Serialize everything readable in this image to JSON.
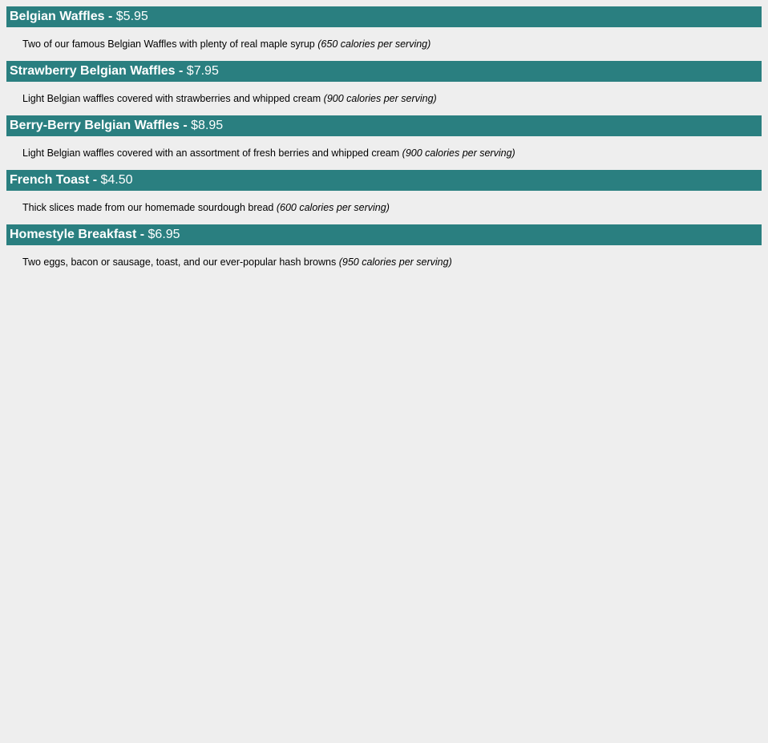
{
  "colors": {
    "header_background": "#2a7f80",
    "header_text": "#ffffff",
    "page_background": "#eeeeee",
    "body_text": "#000000"
  },
  "menu": {
    "separator": " - ",
    "items": [
      {
        "name": "Belgian Waffles",
        "price": "$5.95",
        "description": "Two of our famous Belgian Waffles with plenty of real maple syrup",
        "calories": "(650 calories per serving)"
      },
      {
        "name": "Strawberry Belgian Waffles",
        "price": "$7.95",
        "description": "Light Belgian waffles covered with strawberries and whipped cream",
        "calories": "(900 calories per serving)"
      },
      {
        "name": "Berry-Berry Belgian Waffles",
        "price": "$8.95",
        "description": "Light Belgian waffles covered with an assortment of fresh berries and whipped cream",
        "calories": "(900 calories per serving)"
      },
      {
        "name": "French Toast",
        "price": "$4.50",
        "description": "Thick slices made from our homemade sourdough bread",
        "calories": "(600 calories per serving)"
      },
      {
        "name": "Homestyle Breakfast",
        "price": "$6.95",
        "description": "Two eggs, bacon or sausage, toast, and our ever-popular hash browns",
        "calories": "(950 calories per serving)"
      }
    ]
  }
}
